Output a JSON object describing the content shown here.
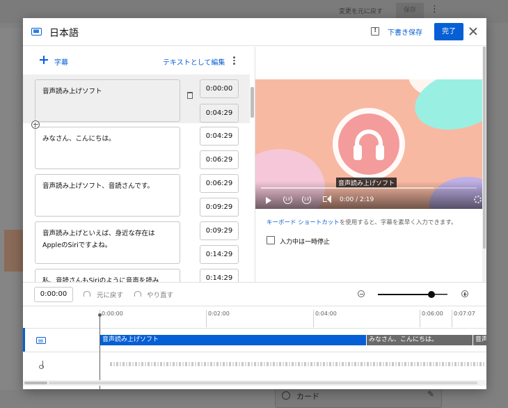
{
  "background": {
    "undo_changes": "変更を元に戻す",
    "save": "保存",
    "card_label": "カード"
  },
  "dialog": {
    "title": "日本語",
    "save_draft": "下書き保存",
    "done": "完了"
  },
  "editor": {
    "add_subtitle": "字幕",
    "edit_as_text": "テキストとして編集",
    "cues": [
      {
        "text": "音声読み上げソフト",
        "start": "0:00:00",
        "end": "0:04:29"
      },
      {
        "text": "みなさん、こんにちは。",
        "start": "0:04:29",
        "end": "0:06:29"
      },
      {
        "text": "音声読み上げソフト、音読さんです。",
        "start": "0:06:29",
        "end": "0:09:29"
      },
      {
        "text": "音声読み上げといえば、身近な存在はAppleのSiriですよね。",
        "start": "0:09:29",
        "end": "0:14:29"
      },
      {
        "text": "私、音読さんもSiriのように音声を読み",
        "start": "0:14:29",
        "end": ""
      }
    ]
  },
  "player": {
    "caption": "音声読み上げソフト",
    "time": "0:00 / 2:19",
    "progress_fraction": 0.8,
    "shortcut_link": "キーボード ショートカット",
    "shortcut_hint": "を使用すると、字幕を素早く入力できます。",
    "pause_while_typing": "入力中は一時停止"
  },
  "timeline": {
    "current_time": "0:00:00",
    "undo": "元に戻す",
    "redo": "やり直す",
    "ruler": [
      "0:00:00",
      "0:02:00",
      "0:04:00",
      "0:06:00",
      "0:07:07"
    ],
    "segments": [
      "音声読み上げソフト",
      "みなさん、こんにちは。",
      "音声"
    ]
  },
  "colors": {
    "accent": "#065fd4",
    "video_bg": "#f8b9a2"
  }
}
